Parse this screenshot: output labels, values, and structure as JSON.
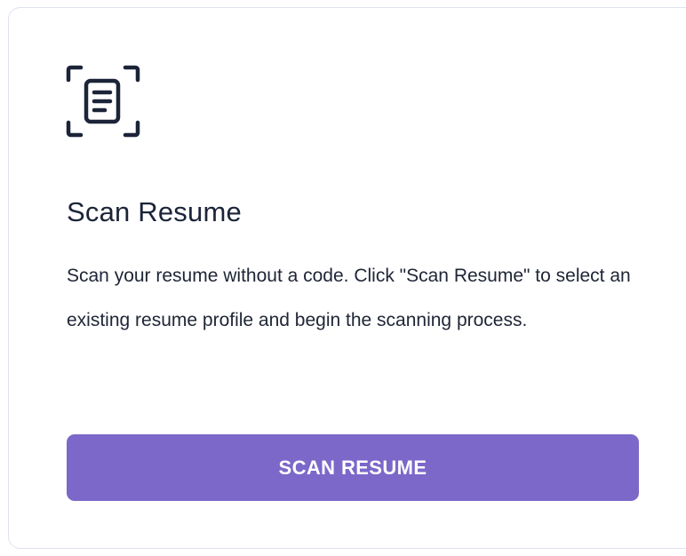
{
  "card": {
    "icon": "document-scan-icon",
    "title": "Scan Resume",
    "description": "Scan your resume without a code. Click \"Scan Resume\" to select an existing resume profile and begin the scanning process.",
    "button_label": "SCAN RESUME"
  },
  "colors": {
    "button_background": "#7b68c9",
    "button_text": "#ffffff",
    "title_text": "#1b2438",
    "body_text": "#1e2535",
    "card_border": "#dde3ee",
    "icon_stroke": "#1b2438"
  }
}
